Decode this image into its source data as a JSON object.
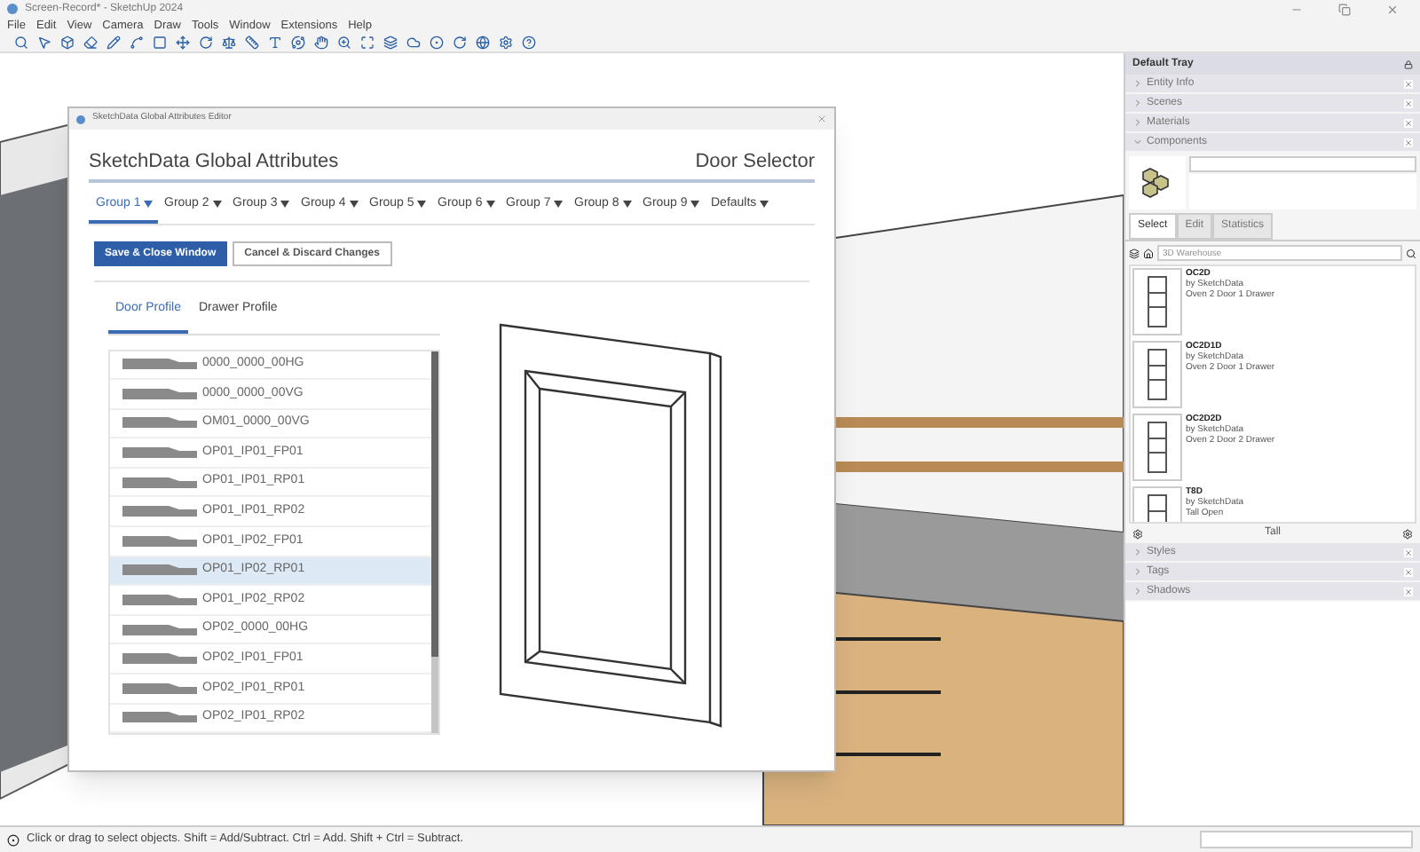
{
  "window": {
    "title": "Screen-Record* - SketchUp 2024"
  },
  "menu": [
    "File",
    "Edit",
    "View",
    "Camera",
    "Draw",
    "Tools",
    "Window",
    "Extensions",
    "Help"
  ],
  "dialog": {
    "title": "SketchData Global Attributes Editor",
    "heading": "SketchData Global Attributes",
    "subheading": "Door Selector",
    "groups": [
      {
        "label": "Group 1",
        "selected": true
      },
      {
        "label": "Group 2",
        "selected": false
      },
      {
        "label": "Group 3",
        "selected": false
      },
      {
        "label": "Group 4",
        "selected": false
      },
      {
        "label": "Group 5",
        "selected": false
      },
      {
        "label": "Group 6",
        "selected": false
      },
      {
        "label": "Group 7",
        "selected": false
      },
      {
        "label": "Group 8",
        "selected": false
      },
      {
        "label": "Group 9",
        "selected": false
      },
      {
        "label": "Defaults",
        "selected": false
      }
    ],
    "buttons": [
      {
        "label": "Save & Close Window",
        "kind": "primary"
      },
      {
        "label": "Cancel & Discard Changes",
        "kind": "secondary"
      }
    ],
    "profile_tabs": [
      {
        "label": "Door Profile",
        "selected": true
      },
      {
        "label": "Drawer Profile",
        "selected": false
      }
    ],
    "profiles": [
      {
        "name": "0000_0000_00HG",
        "selected": false
      },
      {
        "name": "0000_0000_00VG",
        "selected": false
      },
      {
        "name": "OM01_0000_00VG",
        "selected": false
      },
      {
        "name": "OP01_IP01_FP01",
        "selected": false
      },
      {
        "name": "OP01_IP01_RP01",
        "selected": false
      },
      {
        "name": "OP01_IP01_RP02",
        "selected": false
      },
      {
        "name": "OP01_IP02_FP01",
        "selected": false
      },
      {
        "name": "OP01_IP02_RP01",
        "selected": true
      },
      {
        "name": "OP01_IP02_RP02",
        "selected": false
      },
      {
        "name": "OP02_0000_00HG",
        "selected": false
      },
      {
        "name": "OP02_IP01_FP01",
        "selected": false
      },
      {
        "name": "OP02_IP01_RP01",
        "selected": false
      },
      {
        "name": "OP02_IP01_RP02",
        "selected": false
      }
    ]
  },
  "tray": {
    "title": "Default Tray",
    "panels_top": [
      {
        "label": "Entity Info",
        "expanded": false
      },
      {
        "label": "Scenes",
        "expanded": false
      },
      {
        "label": "Materials",
        "expanded": false
      },
      {
        "label": "Components",
        "expanded": true
      }
    ],
    "tabs": [
      {
        "label": "Select",
        "selected": true
      },
      {
        "label": "Edit",
        "selected": false
      },
      {
        "label": "Statistics",
        "selected": false
      }
    ],
    "search": {
      "placeholder": "3D Warehouse"
    },
    "components": [
      {
        "name": "OC2D",
        "author": "by SketchData",
        "description": "Oven 2 Door 1 Drawer"
      },
      {
        "name": "OC2D1D",
        "author": "by SketchData",
        "description": "Oven 2 Door 1 Drawer"
      },
      {
        "name": "OC2D2D",
        "author": "by SketchData",
        "description": "Oven 2 Door 2 Drawer"
      },
      {
        "name": "T8D",
        "author": "by SketchData",
        "description": "Tall Open"
      }
    ],
    "collection": "Tall",
    "panels_bottom": [
      {
        "label": "Styles",
        "expanded": false
      },
      {
        "label": "Tags",
        "expanded": false
      },
      {
        "label": "Shadows",
        "expanded": false
      }
    ]
  },
  "status_bar": {
    "text": "Click or drag to select objects. Shift = Add/Subtract. Ctrl = Add. Shift + Ctrl = Subtract."
  }
}
